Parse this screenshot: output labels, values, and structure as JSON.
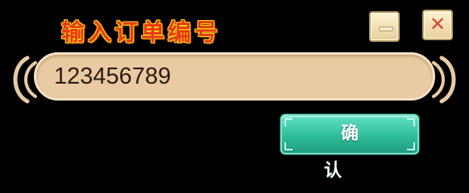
{
  "dialog": {
    "title": "输入订单编号",
    "input": {
      "value": "123456789"
    },
    "confirm_label": "确认",
    "window_buttons": {
      "minimize_icon": "minimize-icon",
      "close_icon": "close-icon",
      "close_glyph": "✕"
    }
  },
  "colors": {
    "background": "#000000",
    "title": "#e63a12",
    "title_outline": "#ffd21a",
    "input_fill": "#e9caa2",
    "confirm_button": "#2fbd9a"
  }
}
